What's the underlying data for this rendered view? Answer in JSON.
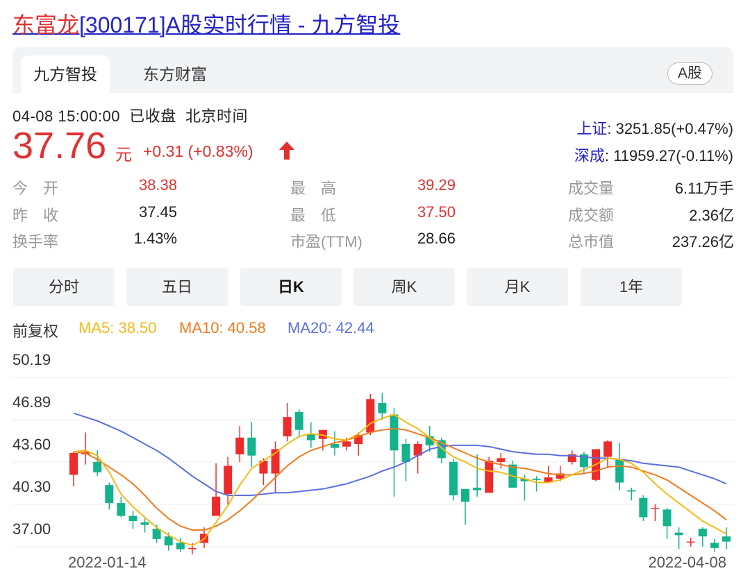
{
  "page": {
    "title_name": "东富龙",
    "title_rest": "[300171]A股实时行情 - 九方智投"
  },
  "tabs": [
    {
      "label": "九方智投"
    },
    {
      "label": "东方财富"
    }
  ],
  "market_badge": "A股",
  "quote": {
    "timestamp": "04-08 15:00:00",
    "status": "已收盘",
    "timezone": "北京时间",
    "price": "37.76",
    "unit": "元",
    "change": "+0.31 (+0.83%)"
  },
  "indices": [
    {
      "name": "上证",
      "value": ": 3251.85(+0.47%)"
    },
    {
      "name": "深成",
      "value": ": 11959.27(-0.11%)"
    }
  ],
  "stats": [
    {
      "label": "今　开",
      "value": "38.38",
      "color": "red"
    },
    {
      "label": "昨　收",
      "value": "37.45",
      "color": "black"
    },
    {
      "label": "换手率",
      "value": "1.43%",
      "color": "black"
    },
    {
      "label": "最　高",
      "value": "39.29",
      "color": "red"
    },
    {
      "label": "最　低",
      "value": "37.50",
      "color": "red"
    },
    {
      "label": "市盈(TTM)",
      "value": "28.66",
      "color": "black"
    },
    {
      "label": "成交量",
      "value": "6.11万手",
      "color": "black"
    },
    {
      "label": "成交额",
      "value": "2.36亿",
      "color": "black"
    },
    {
      "label": "总市值",
      "value": "237.26亿",
      "color": "black"
    }
  ],
  "periods": [
    {
      "label": "分时",
      "active": false
    },
    {
      "label": "五日",
      "active": false
    },
    {
      "label": "日K",
      "active": true
    },
    {
      "label": "周K",
      "active": false
    },
    {
      "label": "月K",
      "active": false
    },
    {
      "label": "1年",
      "active": false
    }
  ],
  "legend": {
    "adjust": "前复权",
    "ma5": "MA5: 38.50",
    "ma10": "MA10: 40.58",
    "ma20": "MA20: 42.44"
  },
  "colors": {
    "up": "#ee2b2b",
    "down": "#14b38c",
    "ma5": "#f5b915",
    "ma10": "#f07b1d",
    "ma20": "#5b6ee1",
    "link": "#2323c8"
  },
  "chart_data": {
    "type": "candlestick",
    "y_ticks": [
      "50.19",
      "46.89",
      "43.60",
      "40.30",
      "37.00"
    ],
    "ylim": [
      37.0,
      50.19
    ],
    "x_start_label": "2022-01-14",
    "x_end_label": "2022-04-08",
    "candles": [
      {
        "o": 42.6,
        "h": 44.4,
        "l": 41.7,
        "c": 44.3
      },
      {
        "o": 44.2,
        "h": 45.9,
        "l": 43.4,
        "c": 44.4
      },
      {
        "o": 43.6,
        "h": 44.5,
        "l": 42.5,
        "c": 42.8
      },
      {
        "o": 41.8,
        "h": 42.0,
        "l": 39.9,
        "c": 40.4
      },
      {
        "o": 40.4,
        "h": 40.9,
        "l": 39.3,
        "c": 39.4
      },
      {
        "o": 39.4,
        "h": 39.8,
        "l": 38.4,
        "c": 39.0
      },
      {
        "o": 38.9,
        "h": 39.2,
        "l": 38.1,
        "c": 38.7
      },
      {
        "o": 38.4,
        "h": 38.7,
        "l": 37.3,
        "c": 37.6
      },
      {
        "o": 37.8,
        "h": 38.1,
        "l": 36.7,
        "c": 37.1
      },
      {
        "o": 37.3,
        "h": 37.7,
        "l": 36.6,
        "c": 36.8
      },
      {
        "o": 36.9,
        "h": 37.3,
        "l": 36.4,
        "c": 36.9
      },
      {
        "o": 37.3,
        "h": 38.5,
        "l": 36.9,
        "c": 38.0
      },
      {
        "o": 39.4,
        "h": 43.5,
        "l": 39.4,
        "c": 40.9
      },
      {
        "o": 41.1,
        "h": 44.0,
        "l": 40.1,
        "c": 43.3
      },
      {
        "o": 44.2,
        "h": 46.4,
        "l": 43.6,
        "c": 45.5
      },
      {
        "o": 45.5,
        "h": 46.7,
        "l": 43.2,
        "c": 44.1
      },
      {
        "o": 42.7,
        "h": 43.9,
        "l": 41.8,
        "c": 43.7
      },
      {
        "o": 42.7,
        "h": 45.2,
        "l": 41.2,
        "c": 44.6
      },
      {
        "o": 45.6,
        "h": 48.2,
        "l": 45.2,
        "c": 47.1
      },
      {
        "o": 47.5,
        "h": 47.7,
        "l": 45.5,
        "c": 46.1
      },
      {
        "o": 45.8,
        "h": 46.7,
        "l": 44.7,
        "c": 45.3
      },
      {
        "o": 45.4,
        "h": 46.1,
        "l": 44.5,
        "c": 46.1
      },
      {
        "o": 45.0,
        "h": 46.0,
        "l": 44.1,
        "c": 44.7
      },
      {
        "o": 44.8,
        "h": 45.5,
        "l": 44.5,
        "c": 45.2
      },
      {
        "o": 45.0,
        "h": 45.9,
        "l": 44.1,
        "c": 45.7
      },
      {
        "o": 45.9,
        "h": 48.9,
        "l": 45.7,
        "c": 48.5
      },
      {
        "o": 48.2,
        "h": 49.0,
        "l": 46.9,
        "c": 47.4
      },
      {
        "o": 47.3,
        "h": 47.8,
        "l": 40.9,
        "c": 44.5
      },
      {
        "o": 45.0,
        "h": 45.4,
        "l": 42.1,
        "c": 43.6
      },
      {
        "o": 44.1,
        "h": 45.2,
        "l": 42.7,
        "c": 45.0
      },
      {
        "o": 45.6,
        "h": 46.4,
        "l": 44.4,
        "c": 44.9
      },
      {
        "o": 45.3,
        "h": 45.5,
        "l": 43.5,
        "c": 43.9
      },
      {
        "o": 43.6,
        "h": 43.8,
        "l": 40.6,
        "c": 41.0
      },
      {
        "o": 41.5,
        "h": 41.5,
        "l": 38.7,
        "c": 40.5
      },
      {
        "o": 41.6,
        "h": 44.2,
        "l": 40.9,
        "c": 41.4
      },
      {
        "o": 41.2,
        "h": 44.0,
        "l": 41.2,
        "c": 43.7
      },
      {
        "o": 43.6,
        "h": 44.3,
        "l": 43.1,
        "c": 43.9
      },
      {
        "o": 43.4,
        "h": 43.7,
        "l": 41.6,
        "c": 41.6
      },
      {
        "o": 42.3,
        "h": 42.6,
        "l": 40.6,
        "c": 42.1
      },
      {
        "o": 42.3,
        "h": 42.5,
        "l": 41.3,
        "c": 42.2
      },
      {
        "o": 42.0,
        "h": 43.3,
        "l": 42.0,
        "c": 42.4
      },
      {
        "o": 42.3,
        "h": 43.3,
        "l": 42.1,
        "c": 42.7
      },
      {
        "o": 43.6,
        "h": 44.5,
        "l": 43.4,
        "c": 44.2
      },
      {
        "o": 44.2,
        "h": 44.4,
        "l": 42.7,
        "c": 43.2
      },
      {
        "o": 42.2,
        "h": 43.9,
        "l": 42.1,
        "c": 44.6
      },
      {
        "o": 44.0,
        "h": 45.3,
        "l": 43.2,
        "c": 45.2
      },
      {
        "o": 43.8,
        "h": 45.1,
        "l": 41.4,
        "c": 42.0
      },
      {
        "o": 41.4,
        "h": 41.6,
        "l": 40.6,
        "c": 41.3
      },
      {
        "o": 40.8,
        "h": 41.0,
        "l": 39.0,
        "c": 39.3
      },
      {
        "o": 40.0,
        "h": 40.3,
        "l": 39.0,
        "c": 40.0
      },
      {
        "o": 39.9,
        "h": 40.0,
        "l": 37.6,
        "c": 38.6
      },
      {
        "o": 38.1,
        "h": 38.5,
        "l": 36.8,
        "c": 37.9
      },
      {
        "o": 37.4,
        "h": 37.7,
        "l": 37.0,
        "c": 37.4
      },
      {
        "o": 38.4,
        "h": 38.5,
        "l": 37.0,
        "c": 37.8
      },
      {
        "o": 37.3,
        "h": 37.6,
        "l": 36.6,
        "c": 36.9
      },
      {
        "o": 37.8,
        "h": 38.5,
        "l": 36.8,
        "c": 37.4
      }
    ],
    "ma5": [
      44.4,
      44.5,
      44.1,
      42.8,
      41.1,
      40.1,
      39.3,
      38.5,
      37.9,
      37.4,
      37.1,
      37.6,
      38.9,
      40.2,
      41.8,
      43.1,
      43.7,
      44.3,
      45.0,
      45.6,
      45.8,
      45.7,
      45.4,
      45.3,
      45.8,
      46.6,
      47.0,
      47.3,
      46.7,
      46.2,
      45.5,
      44.7,
      44.0,
      43.6,
      43.1,
      42.9,
      42.8,
      42.5,
      42.3,
      42.0,
      42.0,
      42.2,
      42.6,
      43.0,
      43.4,
      43.9,
      43.8,
      43.5,
      42.8,
      41.9,
      41.1,
      40.4,
      39.7,
      39.0,
      38.5,
      38.0
    ],
    "ma10": [
      44.4,
      44.3,
      43.8,
      43.2,
      42.6,
      41.9,
      41.0,
      40.0,
      39.2,
      38.6,
      38.3,
      38.3,
      38.6,
      39.1,
      39.8,
      40.6,
      41.5,
      42.4,
      43.3,
      44.0,
      44.5,
      44.8,
      45.1,
      45.3,
      45.6,
      45.9,
      46.1,
      46.2,
      46.1,
      45.8,
      45.5,
      45.1,
      44.7,
      44.3,
      43.9,
      43.6,
      43.4,
      43.2,
      43.1,
      42.9,
      42.7,
      42.6,
      42.6,
      42.7,
      42.9,
      43.2,
      43.3,
      43.2,
      42.9,
      42.6,
      42.2,
      41.6,
      41.0,
      40.4,
      39.8,
      39.1
    ],
    "ma20": [
      47.4,
      47.1,
      46.8,
      46.4,
      46.0,
      45.5,
      45.0,
      44.5,
      43.9,
      43.2,
      42.5,
      41.9,
      41.3,
      41.0,
      41.0,
      41.0,
      41.1,
      41.2,
      41.2,
      41.3,
      41.4,
      41.5,
      41.7,
      41.9,
      42.2,
      42.5,
      42.9,
      43.2,
      43.6,
      44.1,
      44.6,
      44.8,
      44.9,
      44.9,
      44.9,
      44.8,
      44.6,
      44.4,
      44.3,
      44.2,
      44.2,
      44.1,
      44.1,
      44.0,
      43.9,
      43.9,
      43.8,
      43.7,
      43.5,
      43.4,
      43.3,
      43.2,
      42.9,
      42.6,
      42.3,
      41.9
    ]
  }
}
